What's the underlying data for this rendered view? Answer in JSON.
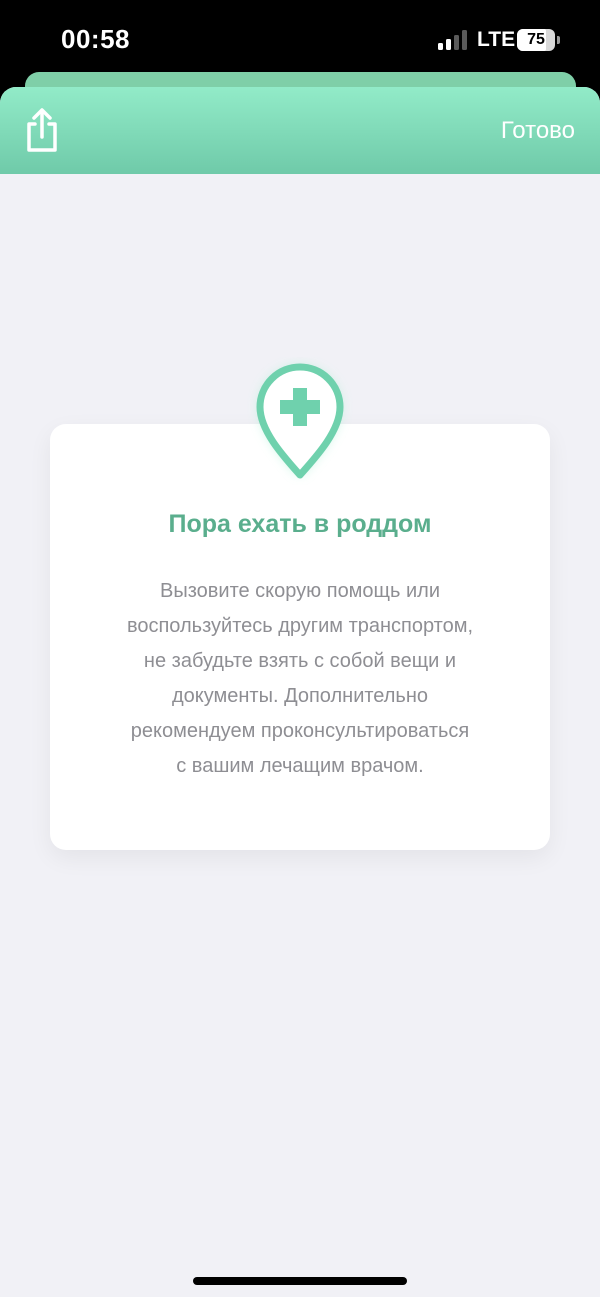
{
  "status_bar": {
    "time": "00:58",
    "network": "LTE",
    "battery_level": "75",
    "signal_bars": 2,
    "signal_bars_total": 4
  },
  "nav": {
    "share_icon": "share-icon",
    "done_label": "Готово",
    "gradient_colors": [
      "#92ebc8",
      "#6fcaa9"
    ]
  },
  "card": {
    "icon": "medical-location-pin-icon",
    "accent_color": "#6fd1ad",
    "title": "Пора ехать в роддом",
    "text_lines": [
      "Вызовите скорую помощь или",
      "воспользуйтесь другим транспортом,",
      "не забудьте взять с собой вещи и",
      "документы. Дополнительно",
      "рекомендуем проконсультироваться",
      "с вашим лечащим врачом."
    ]
  }
}
